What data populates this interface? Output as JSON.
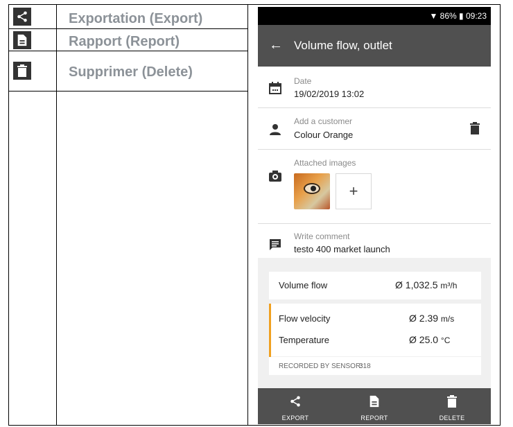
{
  "legend": {
    "export_label": "Exportation (Export)",
    "report_label": "Rapport (Report)",
    "delete_label": "Supprimer (Delete)"
  },
  "status_bar": {
    "text": "▼ 86% ▮ 09:23"
  },
  "app_bar": {
    "title": "Volume flow, outlet"
  },
  "date": {
    "label": "Date",
    "value": "19/02/2019 13:02"
  },
  "customer": {
    "label": "Add a customer",
    "value": "Colour Orange"
  },
  "images": {
    "label": "Attached images",
    "add": "+"
  },
  "comment": {
    "label": "Write comment",
    "value": "testo 400 market launch"
  },
  "measurements": {
    "volume_flow": {
      "label": "Volume flow",
      "value": "Ø 1,032.5 ",
      "unit": "m³/h"
    },
    "flow_velocity": {
      "label": "Flow velocity",
      "value": "Ø 2.39 ",
      "unit": "m/s"
    },
    "temperature": {
      "label": "Temperature",
      "value": "Ø 25.0 ",
      "unit": "°C"
    },
    "sensor": {
      "label": "RECORDED BY SENSOR:",
      "value": "318"
    }
  },
  "bottom_bar": {
    "export": "EXPORT",
    "report": "REPORT",
    "delete": "DELETE"
  },
  "colors": {
    "accent": "#f0a020",
    "bar": "#505050"
  },
  "icons": [
    "share-icon",
    "report-icon",
    "trash-icon",
    "back-arrow-icon",
    "calendar-icon",
    "person-icon",
    "camera-icon",
    "comment-icon"
  ]
}
